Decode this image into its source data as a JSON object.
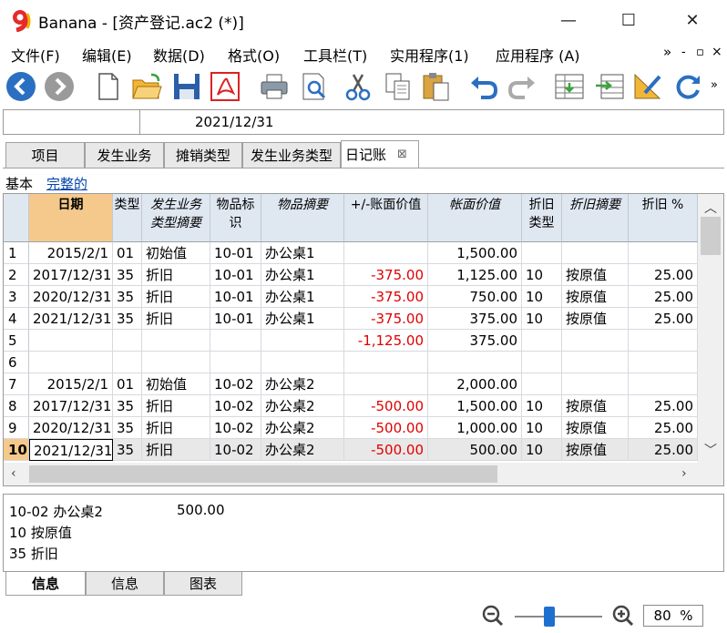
{
  "window": {
    "app": "Banana",
    "title": "Banana - [资产登记.ac2 (*)]",
    "minimize": "—",
    "maximize": "☐",
    "close": "✕"
  },
  "menu": [
    "文件(F)",
    "编辑(E)",
    "数据(D)",
    "格式(O)",
    "工具栏(T)",
    "实用程序(1)",
    "应用程序 (A)"
  ],
  "menu_extra": {
    "more": "»",
    "min": "-",
    "restore": "▫",
    "close": "×"
  },
  "toolbar_icons": [
    "back-icon",
    "forward-icon",
    "new-file-icon",
    "open-folder-icon",
    "save-icon",
    "pdf-icon",
    "print-icon",
    "print-preview-icon",
    "cut-icon",
    "copy-icon",
    "paste-icon",
    "undo-icon",
    "redo-icon",
    "add-row-icon",
    "insert-rows-icon",
    "edit-row-icon",
    "refresh-icon"
  ],
  "cellbar": {
    "value": "2021/12/31"
  },
  "tabs": [
    "项目",
    "发生业务",
    "摊销类型",
    "发生业务类型",
    "日记账"
  ],
  "tab_close": "⊠",
  "views": {
    "basic": "基本",
    "full": "完整的"
  },
  "table": {
    "columns": [
      {
        "label": "日期",
        "italic": false
      },
      {
        "label": "类型",
        "italic": false
      },
      {
        "label": "发生业务类型摘要",
        "italic": true
      },
      {
        "label": "物品标识",
        "italic": false
      },
      {
        "label": "物品摘要",
        "italic": true
      },
      {
        "label": "+/-账面价值",
        "italic": false
      },
      {
        "label": "帐面价值",
        "italic": true
      },
      {
        "label": "折旧类型",
        "italic": false
      },
      {
        "label": "折旧摘要",
        "italic": true
      },
      {
        "label": "折旧 %",
        "italic": false
      }
    ],
    "header_lines": [
      [
        "日期"
      ],
      [
        "类型"
      ],
      [
        "发生业务",
        "类型摘要"
      ],
      [
        "物品标",
        "识"
      ],
      [
        "物品摘要"
      ],
      [
        "+/-账面价值"
      ],
      [
        "帐面价值"
      ],
      [
        "折旧",
        "类型"
      ],
      [
        "折旧摘要"
      ],
      [
        "折旧 %"
      ]
    ],
    "rows": [
      {
        "no": "1",
        "date": "2015/2/1",
        "type": "01",
        "ttext": "初始值",
        "item": "10-01",
        "itext": "办公桌1",
        "delta": "",
        "book": "1,500.00",
        "dtype": "",
        "dtext": "",
        "dpct": ""
      },
      {
        "no": "2",
        "date": "2017/12/31",
        "type": "35",
        "ttext": "折旧",
        "item": "10-01",
        "itext": "办公桌1",
        "delta": "-375.00",
        "book": "1,125.00",
        "dtype": "10",
        "dtext": "按原值",
        "dpct": "25.00"
      },
      {
        "no": "3",
        "date": "2020/12/31",
        "type": "35",
        "ttext": "折旧",
        "item": "10-01",
        "itext": "办公桌1",
        "delta": "-375.00",
        "book": "750.00",
        "dtype": "10",
        "dtext": "按原值",
        "dpct": "25.00"
      },
      {
        "no": "4",
        "date": "2021/12/31",
        "type": "35",
        "ttext": "折旧",
        "item": "10-01",
        "itext": "办公桌1",
        "delta": "-375.00",
        "book": "375.00",
        "dtype": "10",
        "dtext": "按原值",
        "dpct": "25.00"
      },
      {
        "no": "5",
        "date": "",
        "type": "",
        "ttext": "",
        "item": "",
        "itext": "",
        "delta": "-1,125.00",
        "book": "375.00",
        "dtype": "",
        "dtext": "",
        "dpct": ""
      },
      {
        "no": "6",
        "date": "",
        "type": "",
        "ttext": "",
        "item": "",
        "itext": "",
        "delta": "",
        "book": "",
        "dtype": "",
        "dtext": "",
        "dpct": ""
      },
      {
        "no": "7",
        "date": "2015/2/1",
        "type": "01",
        "ttext": "初始值",
        "item": "10-02",
        "itext": "办公桌2",
        "delta": "",
        "book": "2,000.00",
        "dtype": "",
        "dtext": "",
        "dpct": ""
      },
      {
        "no": "8",
        "date": "2017/12/31",
        "type": "35",
        "ttext": "折旧",
        "item": "10-02",
        "itext": "办公桌2",
        "delta": "-500.00",
        "book": "1,500.00",
        "dtype": "10",
        "dtext": "按原值",
        "dpct": "25.00"
      },
      {
        "no": "9",
        "date": "2020/12/31",
        "type": "35",
        "ttext": "折旧",
        "item": "10-02",
        "itext": "办公桌2",
        "delta": "-500.00",
        "book": "1,000.00",
        "dtype": "10",
        "dtext": "按原值",
        "dpct": "25.00"
      },
      {
        "no": "10",
        "date": "2021/12/31",
        "type": "35",
        "ttext": "折旧",
        "item": "10-02",
        "itext": "办公桌2",
        "delta": "-500.00",
        "book": "500.00",
        "dtype": "10",
        "dtext": "按原值",
        "dpct": "25.00"
      }
    ],
    "selected_row": "10"
  },
  "info": {
    "line1_left": "10-02 办公桌2",
    "line1_right": "500.00",
    "line2": "10 按原值",
    "line3": "35 折旧"
  },
  "bottom_tabs": [
    "信息",
    "信息",
    "图表"
  ],
  "zoom": {
    "value": "80",
    "unit": "%",
    "level": 0.4
  },
  "colors": {
    "selected_header": "#f5c98c",
    "header_bg": "#dfe7f1",
    "negative": "#e00000",
    "link": "#0645ad",
    "zoom_thumb": "#1e6fd0"
  }
}
